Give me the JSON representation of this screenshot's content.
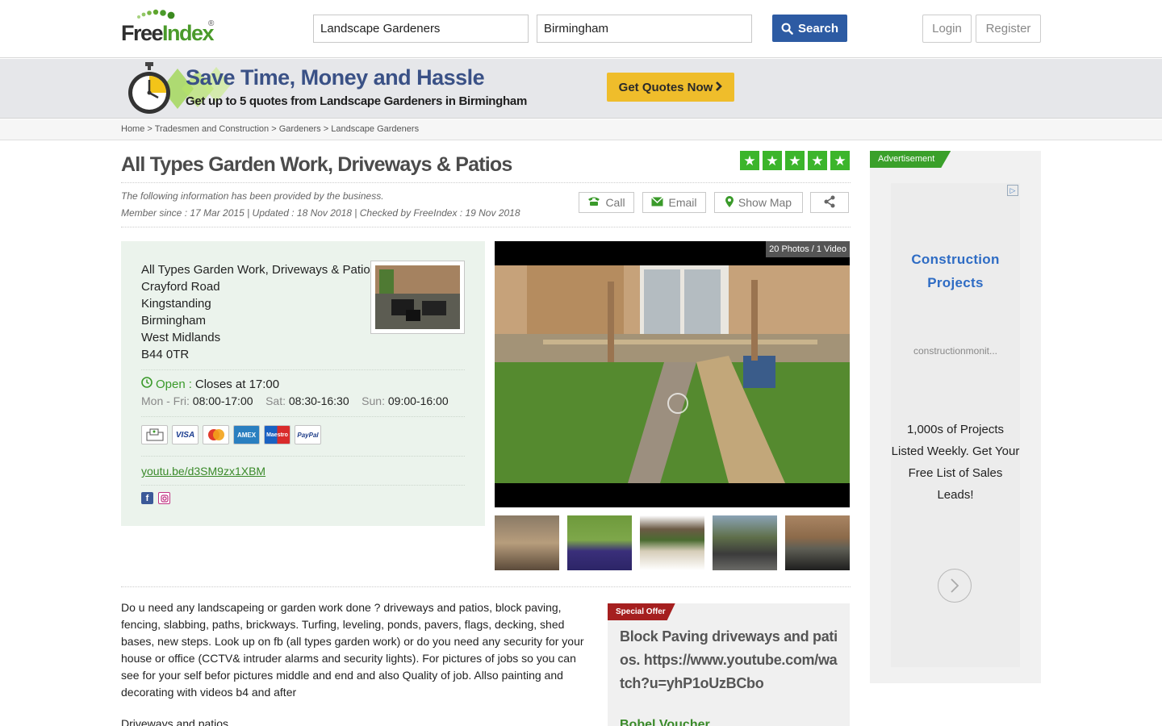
{
  "header": {
    "search_what": "Landscape Gardeners",
    "search_where": "Birmingham",
    "search_button": "Search",
    "login": "Login",
    "register": "Register"
  },
  "logo": {
    "free": "Free",
    "index": "Index",
    "reg": "®"
  },
  "banner": {
    "title": "Save Time, Money and Hassle",
    "subtitle": "Get up to 5 quotes from Landscape Gardeners in Birmingham",
    "button": "Get Quotes Now"
  },
  "breadcrumb": {
    "items": [
      "Home",
      "Tradesmen and Construction",
      "Gardeners",
      "Landscape Gardeners"
    ]
  },
  "business": {
    "title": "All Types Garden Work, Driveways & Patios",
    "rating_stars": 5,
    "provided_note": "The following information has been provided by the business.",
    "member_line": "Member since : 17 Mar 2015 | Updated : 18 Nov 2018 | Checked by FreeIndex : 19 Nov 2018",
    "actions": {
      "call": "Call",
      "email": "Email",
      "map": "Show Map"
    },
    "address": {
      "name": "All Types Garden Work, Driveways & Patios",
      "street": "Crayford Road",
      "area": "Kingstanding",
      "city": "Birmingham",
      "county": "West Midlands",
      "postcode": "B44 0TR"
    },
    "open_status": "Open",
    "closes": "Closes at 17:00",
    "hours": [
      {
        "days": "Mon - Fri:",
        "time": "08:00-17:00"
      },
      {
        "days": "Sat:",
        "time": "08:30-16:30"
      },
      {
        "days": "Sun:",
        "time": "09:00-16:00"
      }
    ],
    "payments": [
      "VISA",
      "AMEX",
      "Maestro",
      "PayPal"
    ],
    "link": "youtu.be/d3SM9zx1XBM",
    "media_count": "20 Photos / 1 Video",
    "description": "Do u need any landscapeing or garden work done ? driveways and patios, block paving, fencing, slabbing, paths, brickways. Turfing, leveling, ponds, pavers, flags, decking, shed bases, new steps. Look up on fb (all types garden work) or do you need any security for your house or office (CCTV& intruder alarms and security lights). For pictures of jobs so you can see for your self befor pictures middle and end and also Quality of job. Allso painting and decorating with videos b4 and after",
    "description_next": "Driveways and patios"
  },
  "offer": {
    "tag": "Special Offer",
    "text": "Block Paving driveways and patios. https://www.youtube.com/watch?u=yhP1oUzBCbo",
    "more": "Bobel Voucher"
  },
  "ad": {
    "tag": "Advertisement",
    "title": "Construction Projects",
    "domain": "constructionmonit...",
    "body": "1,000s of Projects Listed Weekly. Get Your Free List of Sales Leads!"
  },
  "colors": {
    "brand_blue": "#2d5ba3",
    "brand_green": "#3cb52b",
    "quote_yellow": "#efbd2b",
    "offer_red": "#a51f1f"
  }
}
